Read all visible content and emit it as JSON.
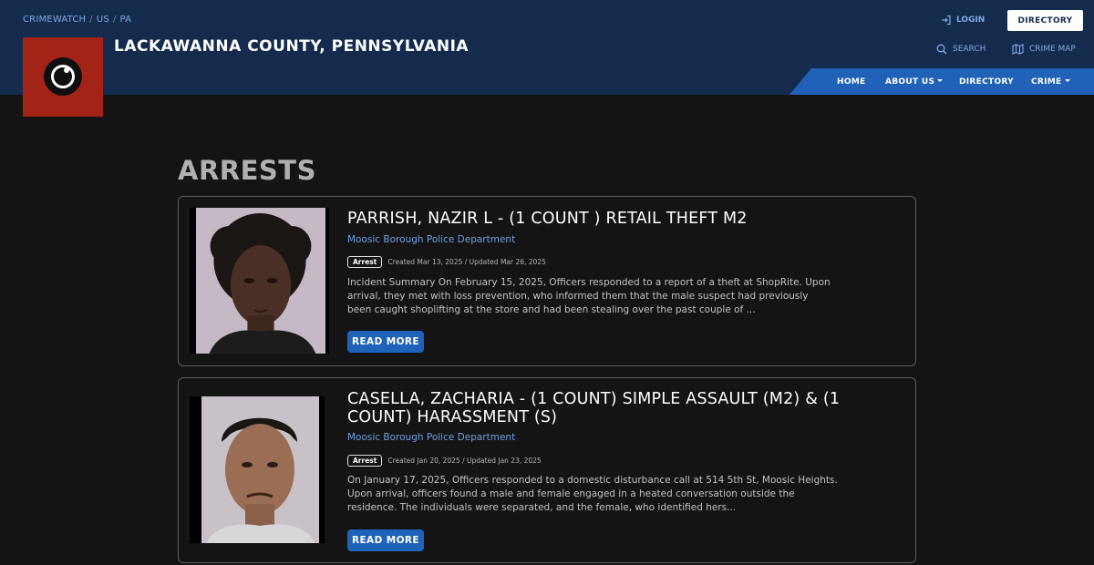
{
  "header": {
    "breadcrumb": [
      "CRIMEWATCH",
      "US",
      "PA"
    ],
    "title": "LACKAWANNA COUNTY, PENNSYLVANIA",
    "login_label": "LOGIN",
    "directory_button": "DIRECTORY",
    "search_label": "SEARCH",
    "crime_map_label": "CRIME MAP"
  },
  "nav": {
    "items": [
      {
        "label": "HOME",
        "dropdown": false
      },
      {
        "label": "ABOUT US",
        "dropdown": true
      },
      {
        "label": "DIRECTORY",
        "dropdown": false
      },
      {
        "label": "CRIME",
        "dropdown": true
      }
    ]
  },
  "colors": {
    "header_bg": "#142b4e",
    "nav_bg": "#1f62b8",
    "logo_bg": "#a32316",
    "link": "#6c9fe0"
  },
  "main": {
    "heading": "ARRESTS",
    "cards": [
      {
        "title": "PARRISH, NAZIR L - (1 COUNT ) RETAIL THEFT M2",
        "department": "Moosic Borough Police Department",
        "badge": "Arrest",
        "dates": "Created Mar 13, 2025 / Updated Mar 26, 2025",
        "summary": "Incident Summary On February 15, 2025, Officers responded to a report of a theft at ShopRite. Upon arrival, they met with loss prevention, who informed them that the male suspect had previously been caught shoplifting at the store and had been stealing over the past couple of ...",
        "button": "READ MORE"
      },
      {
        "title": "CASELLA, ZACHARIA - (1 COUNT) SIMPLE ASSAULT (M2) & (1 COUNT) HARASSMENT (S)",
        "department": "Moosic Borough Police Department",
        "badge": "Arrest",
        "dates": "Created Jan 20, 2025 / Updated Jan 23, 2025",
        "summary": "On January 17, 2025, Officers responded to a domestic disturbance call at 514 5th St, Moosic Heights. Upon arrival, officers found a male and female engaged in a heated conversation outside the residence. The individuals were separated, and the female, who identified hers...",
        "button": "READ MORE"
      }
    ]
  }
}
